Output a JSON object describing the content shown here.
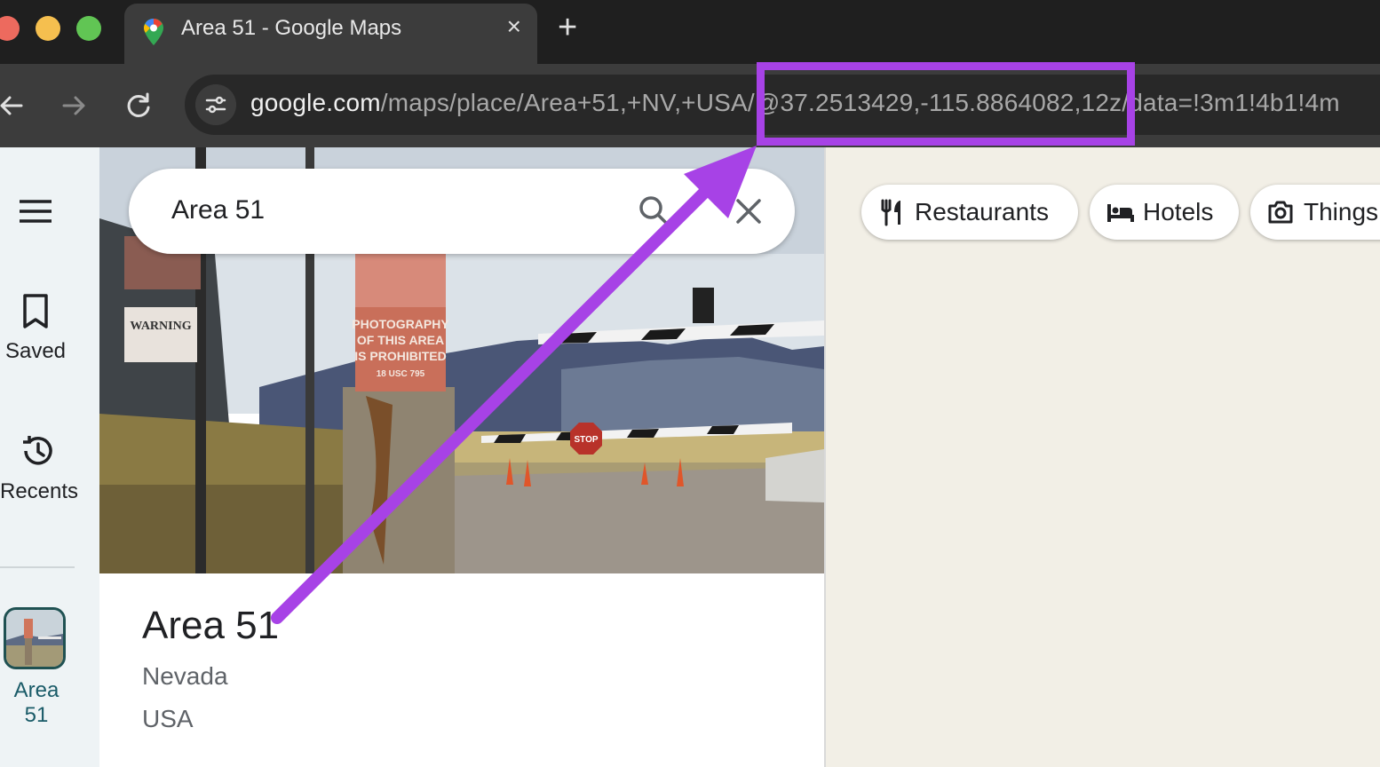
{
  "browser": {
    "tab_title": "Area 51 - Google Maps",
    "tab_close": "×",
    "new_tab": "+",
    "url_host": "google.com",
    "url_path": "/maps/place/Area+51,+NV,+USA/@37.2513429,-115.8864082,12z/data=!3m1!4b1!4m"
  },
  "search": {
    "value": "Area 51"
  },
  "rail": {
    "saved_label": "Saved",
    "recents_label": "Recents",
    "recent_item_label": "Area 51"
  },
  "photo": {
    "sign_warning": "WARNING",
    "sign_photo_line1": "PHOTOGRAPHY",
    "sign_photo_line2": "OF THIS AREA",
    "sign_photo_line3": "IS PROHIBITED",
    "sign_photo_line4": "18 USC 795",
    "stop_sign": "STOP"
  },
  "place": {
    "title": "Area 51",
    "line1": "Nevada",
    "line2": "USA"
  },
  "chips": [
    {
      "label": "Restaurants",
      "icon": "fork-knife-icon"
    },
    {
      "label": "Hotels",
      "icon": "bed-icon"
    },
    {
      "label": "Things",
      "icon": "camera-icon"
    }
  ],
  "colors": {
    "annotation": "#a742e6",
    "map_background": "#f2efe6",
    "rail_background": "#eef3f5"
  }
}
